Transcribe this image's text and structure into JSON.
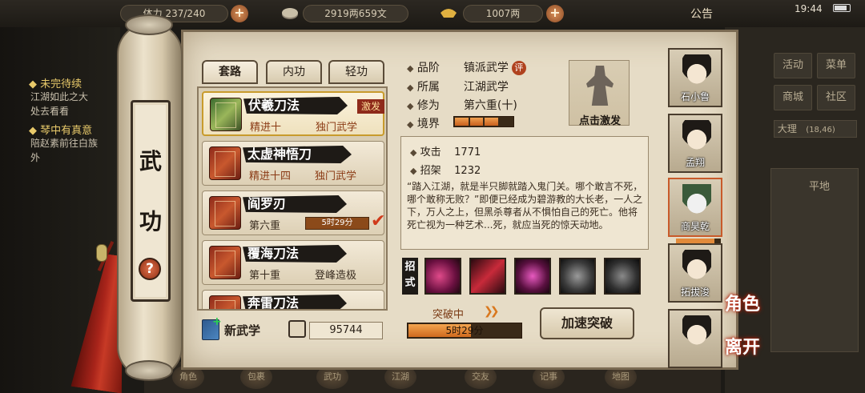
{
  "hud": {
    "stamina": "237/240",
    "stamina_prefix": "体力",
    "money": "2919两659文",
    "ingots": "1007两",
    "notice": "公告",
    "time": "19:44"
  },
  "quests": {
    "q1_title": "未完待续",
    "q1_text_1": "江湖如此之大",
    "q1_text_2": "处去看看",
    "q2_title": "琴中有真意",
    "q2_text_1": "陪赵素前往白族",
    "q2_text_2": "外"
  },
  "right_menu": {
    "b1": "活动",
    "b2": "菜单",
    "b3": "商城",
    "b4": "社区",
    "location": "大理",
    "coords": "(18,46)",
    "sub": "平地"
  },
  "bottom_bar": [
    "角色",
    "包裹",
    "武功",
    "江湖",
    "交友",
    "记事",
    "地图"
  ],
  "scroll": {
    "title_top": "武",
    "title_bottom": "功",
    "help": "?"
  },
  "tabs": [
    "套路",
    "内功",
    "轻功"
  ],
  "skills": [
    {
      "name": "伏羲刀法",
      "progress": "精进十",
      "type": "独门武学",
      "badge": "激发",
      "book": "green"
    },
    {
      "name": "太虚神悟刀",
      "progress": "精进十四",
      "type": "独门武学",
      "badge": "",
      "book": "red"
    },
    {
      "name": "阎罗刃",
      "progress": "第六重",
      "timer": "5时29分",
      "book": "red"
    },
    {
      "name": "覆海刀法",
      "progress": "第十重",
      "type": "登峰造极",
      "book": "red"
    },
    {
      "name": "奔雷刀法",
      "progress": "",
      "type": "",
      "book": "red"
    }
  ],
  "footer": {
    "new_skill": "新武学",
    "points": "95744"
  },
  "details": {
    "grade_label": "品阶",
    "grade": "镇派武学",
    "grade_badge": "评",
    "belong_label": "所属",
    "belong": "江湖武学",
    "cultivation_label": "修为",
    "cultivation": "第六重(十)",
    "realm_label": "境界",
    "realm_level": 3,
    "realm_max": 4,
    "activate_label": "点击激发",
    "attack_label": "攻击",
    "attack": "1771",
    "parry_label": "招架",
    "parry": "1232",
    "description": "“踏入江湖，就是半只脚就踏入鬼门关。哪个敢言不死，哪个敢称无败？”即便已经成为碧游教的大长老，一人之下，万人之上，但黑杀尊者从不惧怕自己的死亡。他将死亡视为一种艺术...死，就应当死的惊天动地。",
    "moves_label": "招式",
    "breakthrough_label": "突破中",
    "breakthrough_time": "5时29分",
    "breakthrough_progress": 0.55,
    "speed_button": "加速突破"
  },
  "characters": [
    {
      "name": "石小鲁"
    },
    {
      "name": "孟翔"
    },
    {
      "name": "商昊乾",
      "selected": true
    },
    {
      "name": "拓拔浚"
    },
    {
      "name": ""
    }
  ],
  "side": {
    "role": "角色",
    "leave": "离开"
  }
}
